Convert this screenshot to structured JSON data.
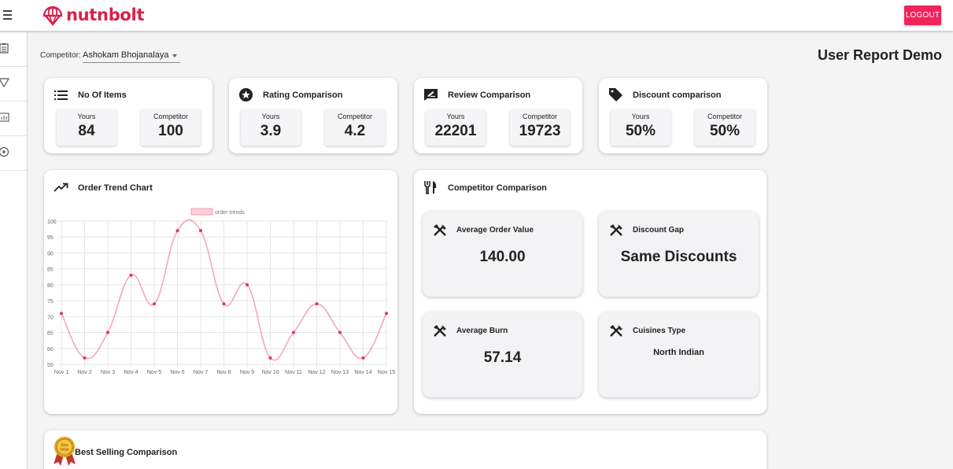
{
  "app": {
    "brand": "nutnbolt",
    "logout_label": "LOGOUT",
    "page_title": "User Report Demo",
    "brand_color": "#d8204a",
    "accent_color": "#f0245a"
  },
  "nav_rail": {
    "items": [
      "clipboard-icon",
      "filter-icon",
      "bar-chart-icon",
      "play-circle-icon"
    ]
  },
  "filter": {
    "competitor_label": "Competitor:",
    "competitor_value": "Ashokam Bhojanalaya"
  },
  "summary_cards": [
    {
      "title": "No Of Items",
      "icon": "list-icon",
      "yours_label": "Yours",
      "yours": "84",
      "competitor_label": "Competitor",
      "competitor": "100"
    },
    {
      "title": "Rating Comparison",
      "icon": "star-circle-icon",
      "yours_label": "Yours",
      "yours": "3.9",
      "competitor_label": "Competitor",
      "competitor": "4.2"
    },
    {
      "title": "Review Comparison",
      "icon": "review-icon",
      "yours_label": "Yours",
      "yours": "22201",
      "competitor_label": "Competitor",
      "competitor": "19723"
    },
    {
      "title": "Discount comparison",
      "icon": "tag-icon",
      "yours_label": "Yours",
      "yours": "50%",
      "competitor_label": "Competitor",
      "competitor": "50%"
    }
  ],
  "order_trend": {
    "title": "Order Trend Chart",
    "icon": "trending-up-icon"
  },
  "chart_data": {
    "type": "line",
    "title": "",
    "legend": "top",
    "categories": [
      "Nov 1",
      "Nov 2",
      "Nov 3",
      "Nov 4",
      "Nov 5",
      "Nov 6",
      "Nov 7",
      "Nov 8",
      "Nov 9",
      "Nov 10",
      "Nov 11",
      "Nov 12",
      "Nov 13",
      "Nov 14",
      "Nov 15"
    ],
    "series": [
      {
        "name": "order trends",
        "values": [
          71,
          57,
          65,
          83,
          74,
          97,
          97,
          74,
          80,
          57,
          65,
          74,
          65,
          57,
          71
        ],
        "color": "#f08aa7",
        "point_color": "#e0336b"
      }
    ],
    "ylim": [
      55,
      100
    ],
    "yticks": [
      55,
      60,
      65,
      70,
      75,
      80,
      85,
      90,
      95,
      100
    ],
    "grid": true,
    "xlabel": "",
    "ylabel": ""
  },
  "competitor_comparison": {
    "title": "Competitor Comparison",
    "icon": "utensils-icon",
    "items": [
      {
        "title": "Average Order Value",
        "value": "140.00"
      },
      {
        "title": "Discount Gap",
        "value": "Same Discounts"
      },
      {
        "title": "Average Burn",
        "value": "57.14"
      },
      {
        "title": "Cuisines Type",
        "value": "North Indian"
      }
    ]
  },
  "best_selling": {
    "title": "Best Selling Comparison",
    "badge_text": "Best Seller",
    "icon": "best-seller-badge-icon"
  }
}
